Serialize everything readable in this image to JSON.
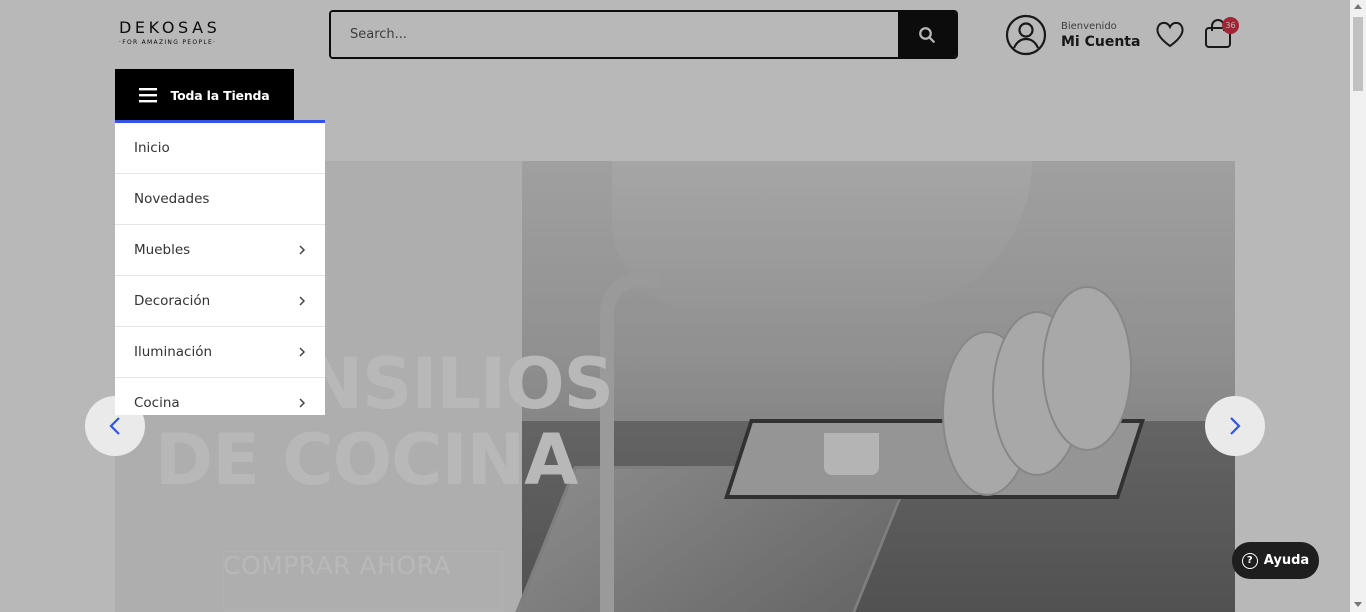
{
  "header": {
    "logo_main": "DEKOSAS",
    "logo_sub": "·FOR AMAZING PEOPLE·",
    "search_placeholder": "Search...",
    "account_greeting": "Bienvenido",
    "account_label": "Mi Cuenta",
    "cart_count": "36"
  },
  "nav": {
    "all_store_label": "Toda la Tienda",
    "menu_items": [
      {
        "label": "Inicio",
        "has_submenu": false
      },
      {
        "label": "Novedades",
        "has_submenu": false
      },
      {
        "label": "Muebles",
        "has_submenu": true
      },
      {
        "label": "Decoración",
        "has_submenu": true
      },
      {
        "label": "Iluminación",
        "has_submenu": true
      },
      {
        "label": "Cocina",
        "has_submenu": true
      }
    ]
  },
  "hero": {
    "title_line1": "UTENSILIOS",
    "title_line2": "DE COCINA",
    "cta": "COMPRAR AHORA"
  },
  "help": {
    "label": "Ayuda"
  },
  "colors": {
    "accent_blue": "#2f54eb",
    "badge_red": "#e0344a",
    "dark": "#111111"
  }
}
